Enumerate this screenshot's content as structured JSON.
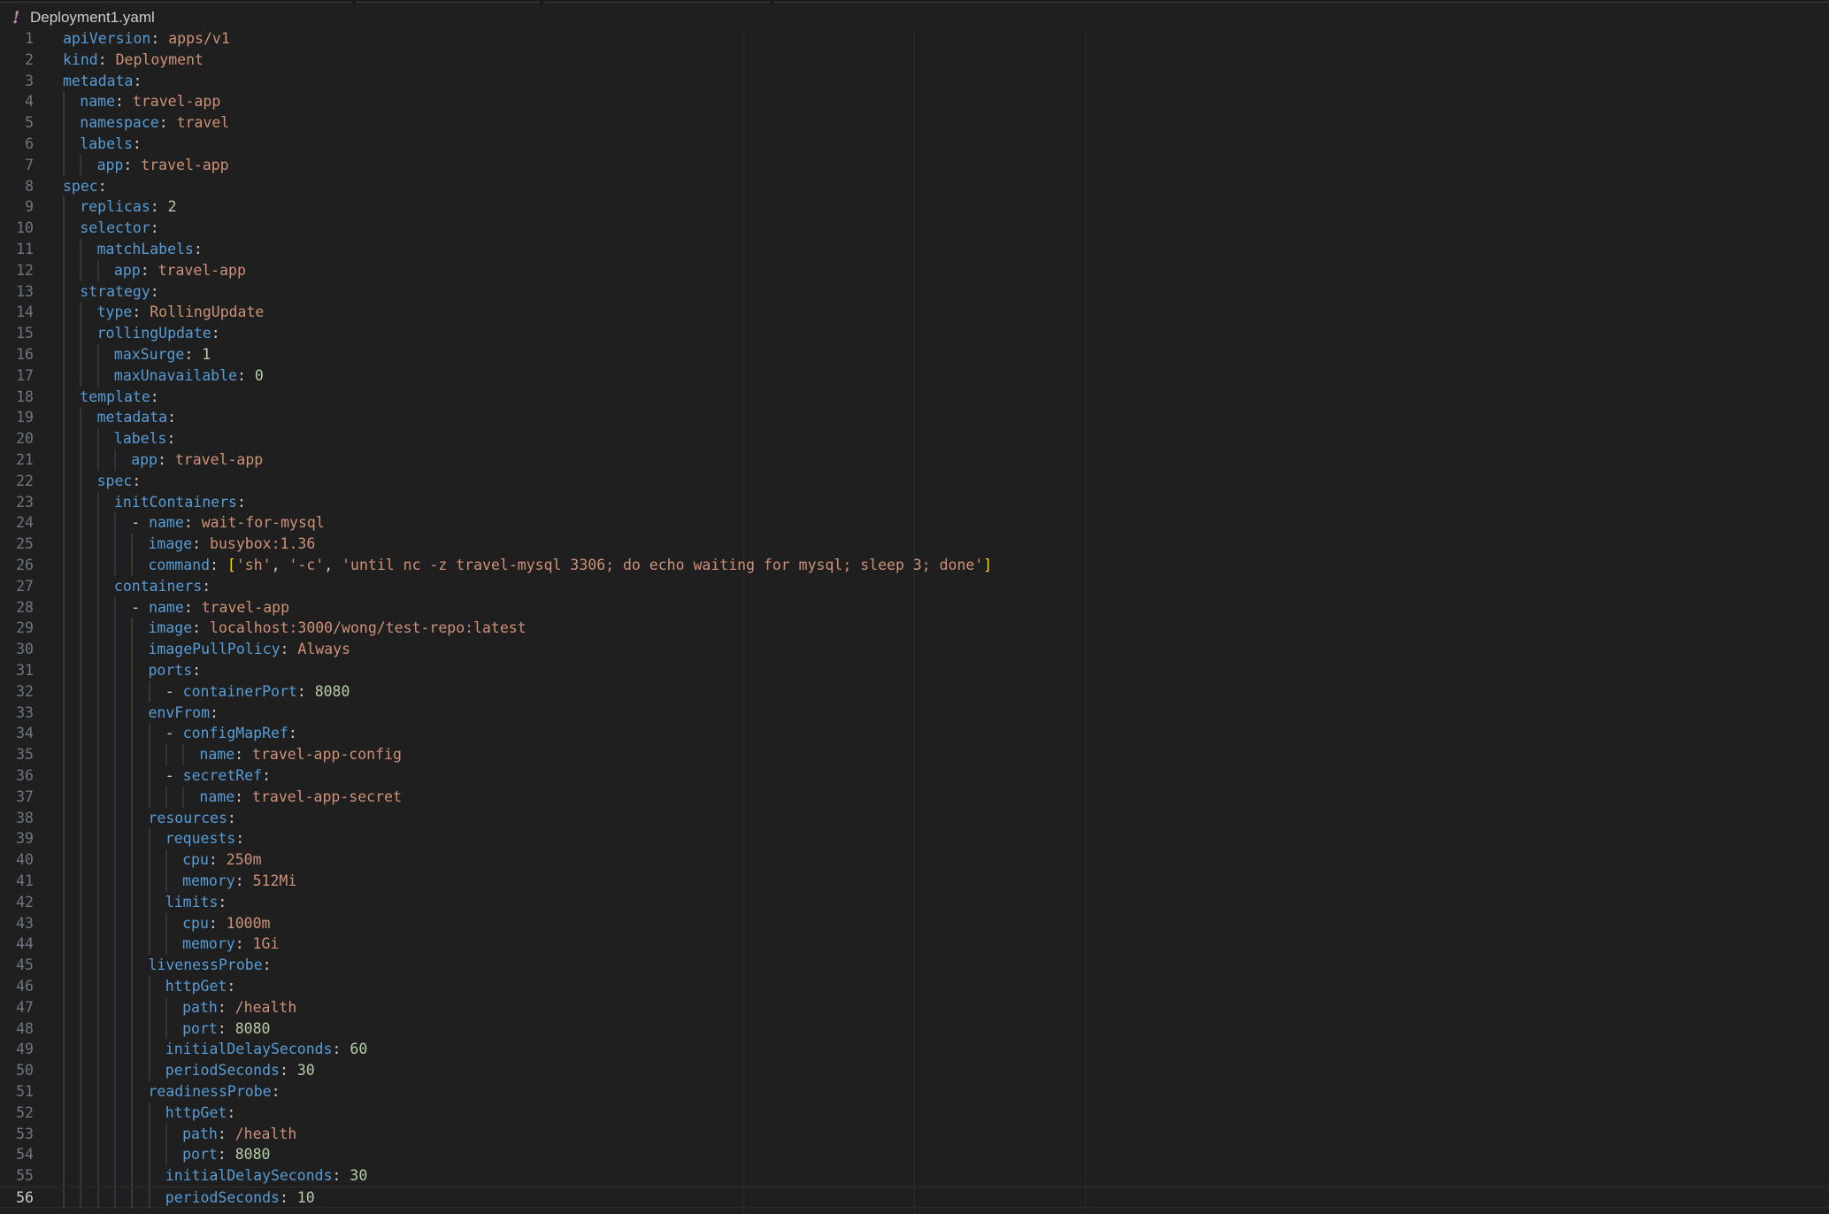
{
  "tab": {
    "filename": "Deployment1.yaml",
    "icon": "exclamation-icon"
  },
  "colors": {
    "background": "#1f1f1f",
    "key": "#569cd6",
    "string": "#ce9178",
    "number": "#b5cea8",
    "bracket": "#ffd700",
    "tab_icon": "#c586c0"
  },
  "editor": {
    "current_line": 56,
    "lines": [
      {
        "n": "1",
        "indent": 0,
        "dash": false,
        "key": "apiVersion",
        "val": "apps/v1",
        "vtype": "s"
      },
      {
        "n": "2",
        "indent": 0,
        "dash": false,
        "key": "kind",
        "val": "Deployment",
        "vtype": "s"
      },
      {
        "n": "3",
        "indent": 0,
        "dash": false,
        "key": "metadata",
        "val": "",
        "vtype": ""
      },
      {
        "n": "4",
        "indent": 1,
        "dash": false,
        "key": "name",
        "val": "travel-app",
        "vtype": "s"
      },
      {
        "n": "5",
        "indent": 1,
        "dash": false,
        "key": "namespace",
        "val": "travel",
        "vtype": "s"
      },
      {
        "n": "6",
        "indent": 1,
        "dash": false,
        "key": "labels",
        "val": "",
        "vtype": ""
      },
      {
        "n": "7",
        "indent": 2,
        "dash": false,
        "key": "app",
        "val": "travel-app",
        "vtype": "s"
      },
      {
        "n": "8",
        "indent": 0,
        "dash": false,
        "key": "spec",
        "val": "",
        "vtype": ""
      },
      {
        "n": "9",
        "indent": 1,
        "dash": false,
        "key": "replicas",
        "val": "2",
        "vtype": "n"
      },
      {
        "n": "10",
        "indent": 1,
        "dash": false,
        "key": "selector",
        "val": "",
        "vtype": ""
      },
      {
        "n": "11",
        "indent": 2,
        "dash": false,
        "key": "matchLabels",
        "val": "",
        "vtype": ""
      },
      {
        "n": "12",
        "indent": 3,
        "dash": false,
        "key": "app",
        "val": "travel-app",
        "vtype": "s"
      },
      {
        "n": "13",
        "indent": 1,
        "dash": false,
        "key": "strategy",
        "val": "",
        "vtype": ""
      },
      {
        "n": "14",
        "indent": 2,
        "dash": false,
        "key": "type",
        "val": "RollingUpdate",
        "vtype": "s"
      },
      {
        "n": "15",
        "indent": 2,
        "dash": false,
        "key": "rollingUpdate",
        "val": "",
        "vtype": ""
      },
      {
        "n": "16",
        "indent": 3,
        "dash": false,
        "key": "maxSurge",
        "val": "1",
        "vtype": "n"
      },
      {
        "n": "17",
        "indent": 3,
        "dash": false,
        "key": "maxUnavailable",
        "val": "0",
        "vtype": "n"
      },
      {
        "n": "18",
        "indent": 1,
        "dash": false,
        "key": "template",
        "val": "",
        "vtype": ""
      },
      {
        "n": "19",
        "indent": 2,
        "dash": false,
        "key": "metadata",
        "val": "",
        "vtype": ""
      },
      {
        "n": "20",
        "indent": 3,
        "dash": false,
        "key": "labels",
        "val": "",
        "vtype": ""
      },
      {
        "n": "21",
        "indent": 4,
        "dash": false,
        "key": "app",
        "val": "travel-app",
        "vtype": "s"
      },
      {
        "n": "22",
        "indent": 2,
        "dash": false,
        "key": "spec",
        "val": "",
        "vtype": ""
      },
      {
        "n": "23",
        "indent": 3,
        "dash": false,
        "key": "initContainers",
        "val": "",
        "vtype": ""
      },
      {
        "n": "24",
        "indent": 4,
        "dash": true,
        "key": "name",
        "val": "wait-for-mysql",
        "vtype": "s"
      },
      {
        "n": "25",
        "indent": 5,
        "dash": false,
        "key": "image",
        "val": "busybox:1.36",
        "vtype": "s"
      },
      {
        "n": "26",
        "indent": 5,
        "dash": false,
        "key": "command",
        "val": "",
        "vtype": "arr",
        "items": [
          "'sh'",
          "'-c'",
          "'until nc -z travel-mysql 3306; do echo waiting for mysql; sleep 3; done'"
        ]
      },
      {
        "n": "27",
        "indent": 3,
        "dash": false,
        "key": "containers",
        "val": "",
        "vtype": ""
      },
      {
        "n": "28",
        "indent": 4,
        "dash": true,
        "key": "name",
        "val": "travel-app",
        "vtype": "s"
      },
      {
        "n": "29",
        "indent": 5,
        "dash": false,
        "key": "image",
        "val": "localhost:3000/wong/test-repo:latest",
        "vtype": "s"
      },
      {
        "n": "30",
        "indent": 5,
        "dash": false,
        "key": "imagePullPolicy",
        "val": "Always",
        "vtype": "s"
      },
      {
        "n": "31",
        "indent": 5,
        "dash": false,
        "key": "ports",
        "val": "",
        "vtype": ""
      },
      {
        "n": "32",
        "indent": 6,
        "dash": true,
        "key": "containerPort",
        "val": "8080",
        "vtype": "n"
      },
      {
        "n": "33",
        "indent": 5,
        "dash": false,
        "key": "envFrom",
        "val": "",
        "vtype": ""
      },
      {
        "n": "34",
        "indent": 6,
        "dash": true,
        "key": "configMapRef",
        "val": "",
        "vtype": ""
      },
      {
        "n": "35",
        "indent": 8,
        "dash": false,
        "key": "name",
        "val": "travel-app-config",
        "vtype": "s"
      },
      {
        "n": "36",
        "indent": 6,
        "dash": true,
        "key": "secretRef",
        "val": "",
        "vtype": ""
      },
      {
        "n": "37",
        "indent": 8,
        "dash": false,
        "key": "name",
        "val": "travel-app-secret",
        "vtype": "s"
      },
      {
        "n": "38",
        "indent": 5,
        "dash": false,
        "key": "resources",
        "val": "",
        "vtype": ""
      },
      {
        "n": "39",
        "indent": 6,
        "dash": false,
        "key": "requests",
        "val": "",
        "vtype": ""
      },
      {
        "n": "40",
        "indent": 7,
        "dash": false,
        "key": "cpu",
        "val": "250m",
        "vtype": "s"
      },
      {
        "n": "41",
        "indent": 7,
        "dash": false,
        "key": "memory",
        "val": "512Mi",
        "vtype": "s"
      },
      {
        "n": "42",
        "indent": 6,
        "dash": false,
        "key": "limits",
        "val": "",
        "vtype": ""
      },
      {
        "n": "43",
        "indent": 7,
        "dash": false,
        "key": "cpu",
        "val": "1000m",
        "vtype": "s"
      },
      {
        "n": "44",
        "indent": 7,
        "dash": false,
        "key": "memory",
        "val": "1Gi",
        "vtype": "s"
      },
      {
        "n": "45",
        "indent": 5,
        "dash": false,
        "key": "livenessProbe",
        "val": "",
        "vtype": ""
      },
      {
        "n": "46",
        "indent": 6,
        "dash": false,
        "key": "httpGet",
        "val": "",
        "vtype": ""
      },
      {
        "n": "47",
        "indent": 7,
        "dash": false,
        "key": "path",
        "val": "/health",
        "vtype": "s"
      },
      {
        "n": "48",
        "indent": 7,
        "dash": false,
        "key": "port",
        "val": "8080",
        "vtype": "n"
      },
      {
        "n": "49",
        "indent": 6,
        "dash": false,
        "key": "initialDelaySeconds",
        "val": "60",
        "vtype": "n"
      },
      {
        "n": "50",
        "indent": 6,
        "dash": false,
        "key": "periodSeconds",
        "val": "30",
        "vtype": "n"
      },
      {
        "n": "51",
        "indent": 5,
        "dash": false,
        "key": "readinessProbe",
        "val": "",
        "vtype": ""
      },
      {
        "n": "52",
        "indent": 6,
        "dash": false,
        "key": "httpGet",
        "val": "",
        "vtype": ""
      },
      {
        "n": "53",
        "indent": 7,
        "dash": false,
        "key": "path",
        "val": "/health",
        "vtype": "s"
      },
      {
        "n": "54",
        "indent": 7,
        "dash": false,
        "key": "port",
        "val": "8080",
        "vtype": "n"
      },
      {
        "n": "55",
        "indent": 6,
        "dash": false,
        "key": "initialDelaySeconds",
        "val": "30",
        "vtype": "n"
      },
      {
        "n": "56",
        "indent": 6,
        "dash": false,
        "key": "periodSeconds",
        "val": "10",
        "vtype": "n"
      }
    ]
  }
}
